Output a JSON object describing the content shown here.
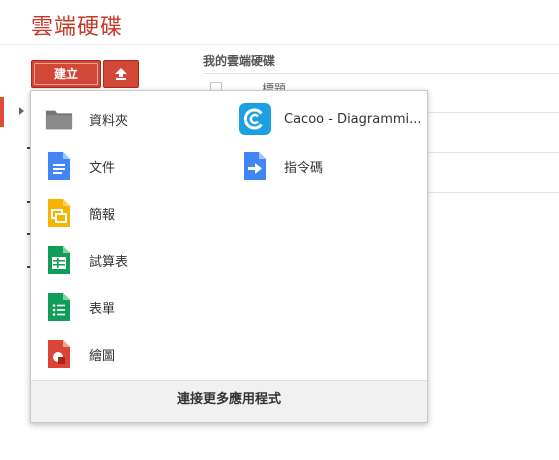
{
  "app": {
    "title": "雲端硬碟"
  },
  "toolbar": {
    "create_label": "建立"
  },
  "main": {
    "breadcrumb": "我的雲端硬碟",
    "column_title": "標題"
  },
  "create_menu": {
    "left_items": [
      {
        "label": "資料夾",
        "icon": "folder-icon"
      },
      {
        "label": "文件",
        "icon": "docs-icon"
      },
      {
        "label": "簡報",
        "icon": "slides-icon"
      },
      {
        "label": "試算表",
        "icon": "sheets-icon"
      },
      {
        "label": "表單",
        "icon": "forms-icon"
      },
      {
        "label": "繪圖",
        "icon": "drawings-icon"
      }
    ],
    "right_items": [
      {
        "label": "Cacoo - Diagrammi...",
        "icon": "cacoo-icon"
      },
      {
        "label": "指令碼",
        "icon": "script-icon"
      }
    ],
    "footer_label": "連接更多應用程式"
  },
  "colors": {
    "accent": "#d14836",
    "title": "#c53929",
    "docs": "#4285f4",
    "slides": "#f4b400",
    "sheets": "#0f9d58",
    "drawings": "#db4437",
    "cacoo": "#1ba1e2"
  }
}
